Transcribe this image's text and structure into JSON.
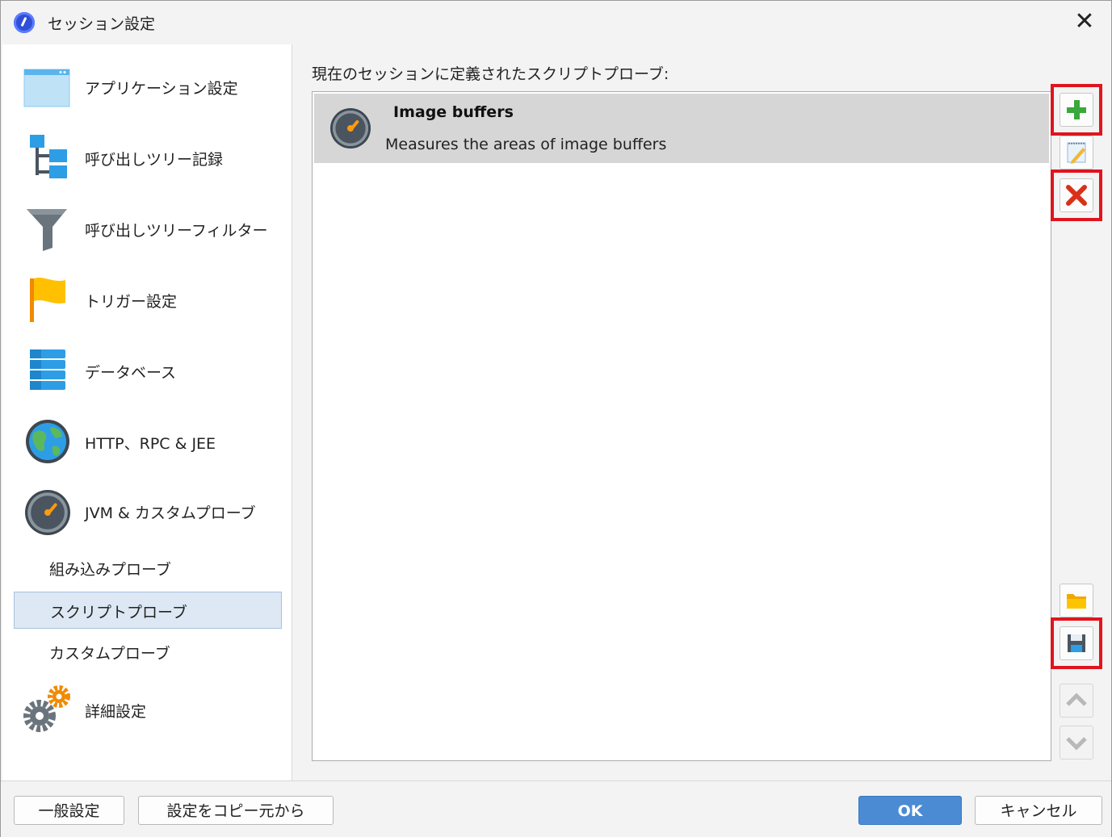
{
  "window": {
    "title": "セッション設定"
  },
  "sidebar": {
    "items": [
      {
        "label": "アプリケーション設定",
        "icon": "application-window-icon"
      },
      {
        "label": "呼び出しツリー記録",
        "icon": "call-tree-icon"
      },
      {
        "label": "呼び出しツリーフィルター",
        "icon": "funnel-icon"
      },
      {
        "label": "トリガー設定",
        "icon": "flag-icon"
      },
      {
        "label": "データベース",
        "icon": "database-icon"
      },
      {
        "label": "HTTP、RPC & JEE",
        "icon": "globe-icon"
      },
      {
        "label": "JVM & カスタムプローブ",
        "icon": "gauge-icon"
      }
    ],
    "subitems": [
      {
        "label": "組み込みプローブ"
      },
      {
        "label": "スクリプトプローブ",
        "selected": true
      },
      {
        "label": "カスタムプローブ"
      }
    ],
    "advanced": {
      "label": "詳細設定",
      "icon": "gears-icon"
    }
  },
  "main": {
    "heading": "現在のセッションに定義されたスクリプトプローブ:",
    "probes": [
      {
        "name": "Image buffers",
        "description": "Measures the areas of image buffers",
        "icon": "gauge-icon"
      }
    ]
  },
  "toolbar": {
    "add": "add-icon",
    "edit": "edit-icon",
    "delete": "delete-icon",
    "open": "folder-icon",
    "save": "save-icon",
    "up": "move-up-icon",
    "down": "move-down-icon"
  },
  "footer": {
    "general": "一般設定",
    "copy": "設定をコピー元から",
    "ok": "OK",
    "cancel": "キャンセル"
  },
  "colors": {
    "highlight": "#e0141e",
    "primary": "#4a8bd4",
    "selection": "#dde8f4"
  }
}
